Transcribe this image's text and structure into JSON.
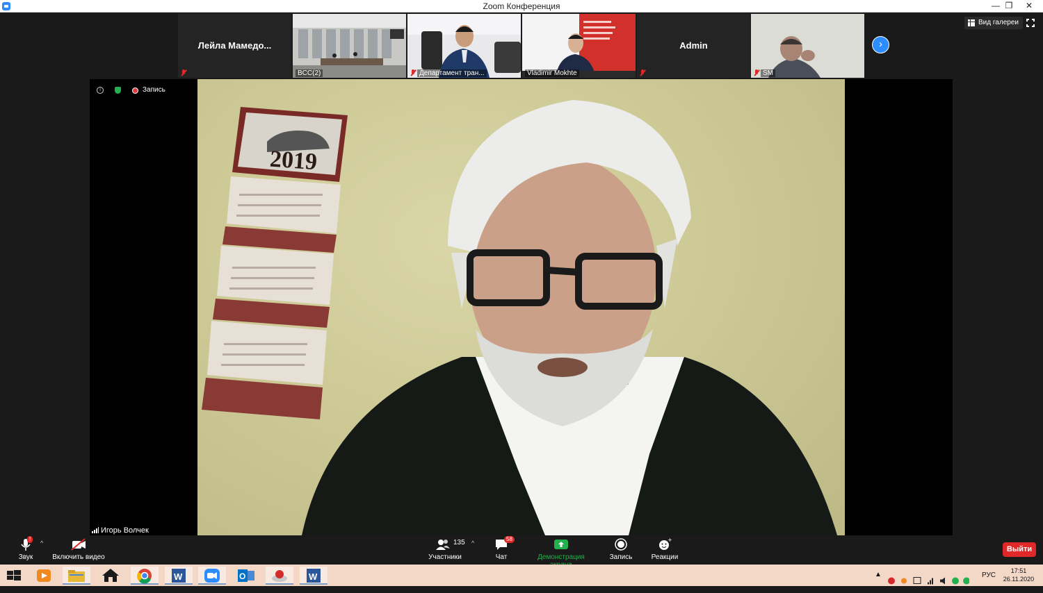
{
  "window": {
    "title": "Zoom Конференция",
    "minimize": "—",
    "restore": "❐",
    "close": "✕"
  },
  "thumbnails": [
    {
      "name": "Лейла  Мамедо...",
      "label": "",
      "muted": true,
      "has_video": false
    },
    {
      "name": "",
      "label": "BCC(2)",
      "muted": false,
      "has_video": true
    },
    {
      "name": "",
      "label": "Департамент тран...",
      "muted": true,
      "has_video": true
    },
    {
      "name": "",
      "label": "Vladimir Mokhte",
      "muted": false,
      "has_video": true
    },
    {
      "name": "Admin",
      "label": "",
      "muted": true,
      "has_video": false
    },
    {
      "name": "",
      "label": "SM",
      "muted": true,
      "has_video": true
    }
  ],
  "gallery_view_label": "Вид галереи",
  "recording_label": "Запись",
  "speaker_name": "Игорь Волчек",
  "calendar_year": "2019",
  "toolbar": {
    "audio_label": "Звук",
    "video_label": "Включить видео",
    "participants_label": "Участники",
    "participants_count": "135",
    "chat_label": "Чат",
    "chat_badge": "58",
    "share_label": "Демонстрация экрана",
    "record_label": "Запись",
    "reactions_label": "Реакции",
    "leave_label": "Выйти",
    "audio_badge": "!"
  },
  "taskbar": {
    "language": "РУС",
    "time": "17:51",
    "date": "26.11.2020"
  },
  "colors": {
    "zoom_blue": "#2d8cff",
    "leave_red": "#e02828",
    "share_green": "#22b14c",
    "taskbar_bg": "#f3d8c8"
  }
}
